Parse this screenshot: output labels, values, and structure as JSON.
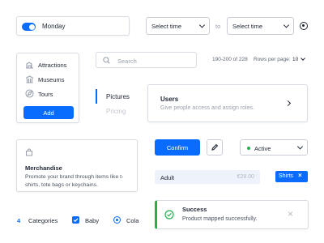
{
  "toggle_card": {
    "label": "Monday",
    "checked": true
  },
  "time_range": {
    "start_placeholder": "Select time",
    "separator": "to",
    "end_placeholder": "Select time"
  },
  "sidebar": {
    "items": [
      {
        "label": "Attractions",
        "icon": "attractions-icon"
      },
      {
        "label": "Museums",
        "icon": "museum-icon"
      },
      {
        "label": "Tours",
        "icon": "tours-icon"
      }
    ],
    "add_label": "Add"
  },
  "search": {
    "placeholder": "Search"
  },
  "pagination": {
    "range_text": "190-200 of 228",
    "rows_label": "Rows per page:",
    "rows_value": "10"
  },
  "tabs": [
    {
      "label": "Pictures",
      "active": true
    },
    {
      "label": "Pricing",
      "active": false
    }
  ],
  "users_card": {
    "title": "Users",
    "description": "Give people access and assign roles."
  },
  "merch_card": {
    "title": "Merchandise",
    "description": "Promote your brand through items like t-shirts, tote bags or keychains."
  },
  "actions": {
    "confirm_label": "Confirm"
  },
  "status_select": {
    "value": "Active",
    "dot_color": "#22b14c"
  },
  "price_row": {
    "label": "Adult",
    "price": "€28.00"
  },
  "tag": {
    "label": "Shirts"
  },
  "toast": {
    "title": "Success",
    "message": "Product mapped successfully.",
    "accent": "#22b14c"
  },
  "filters": {
    "count": "4",
    "count_label": "Categories",
    "checkbox_label": "Baby",
    "radio_label": "Cola"
  },
  "colors": {
    "primary": "#0a6cff",
    "border": "#d8dce3",
    "muted": "#9aa1ad",
    "success": "#22b14c"
  }
}
